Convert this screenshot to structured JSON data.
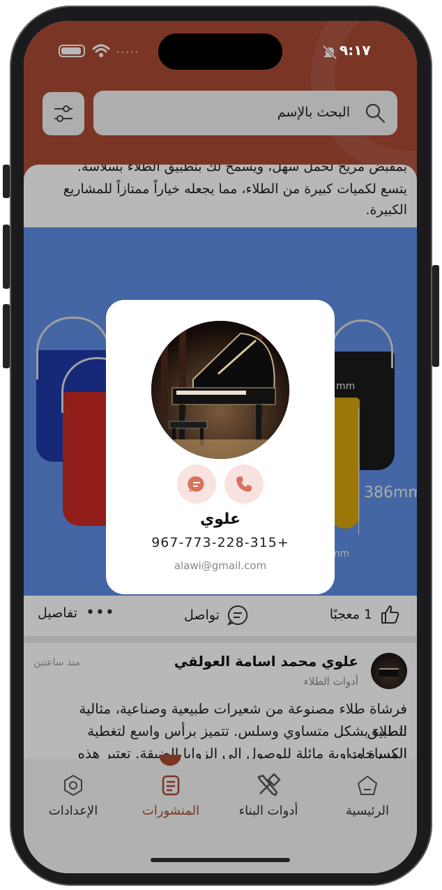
{
  "status_bar": {
    "time": "٩:١٧",
    "signal_dots": "....."
  },
  "search": {
    "placeholder": "البحث بالإسم"
  },
  "post1": {
    "text_line1": "بمقبض مريح لحمل سهل، ويسمح لك بتطبيق الطلاء بسلاسة.",
    "text_line2": "يتسع لكميات كبيرة من الطلاء، مما يجعله خياراً ممتازاً للمشاريع",
    "text_line3": "الكبيرة.",
    "image_labels": {
      "right_dim": "386mm",
      "right_unit_top": "mm",
      "right_unit_bottom": "mm"
    },
    "actions": {
      "likes": "1 معجبًا",
      "contact": "تواصل",
      "details": "تفاصيل"
    }
  },
  "post2": {
    "author": "علوي محمد اسامة العولقي",
    "category": "أدوات الطلاء",
    "time_ago": "منذ ساعتين",
    "text_line1": "فرشاة طلاء مصنوعة من شعيرات طبيعية وصناعية، مثالية لتطبيق",
    "text_line2": "الطلاء بشكل متساوي وسلس. تتميز برأس واسع لتغطية المساحات",
    "text_line3": "الكبيرة وزاوية مائلة للوصول إلى الزوايا الضيقة. تعتبر هذه الفرشاة"
  },
  "nav": {
    "items": [
      {
        "label": "الرئيسية",
        "icon": "home-icon",
        "active": false
      },
      {
        "label": "أدوات البناء",
        "icon": "tools-icon",
        "active": false
      },
      {
        "label": "المنشورات",
        "icon": "posts-icon",
        "active": true
      },
      {
        "label": "الإعدادات",
        "icon": "settings-icon",
        "active": false
      }
    ]
  },
  "contact_card": {
    "name": "علوي",
    "phone": "967-773-228-315+",
    "email": "alawi@gmail.com"
  },
  "colors": {
    "brand": "#a94a34",
    "accent_soft": "#f8e3e0",
    "icon_accent": "#d9725f"
  }
}
